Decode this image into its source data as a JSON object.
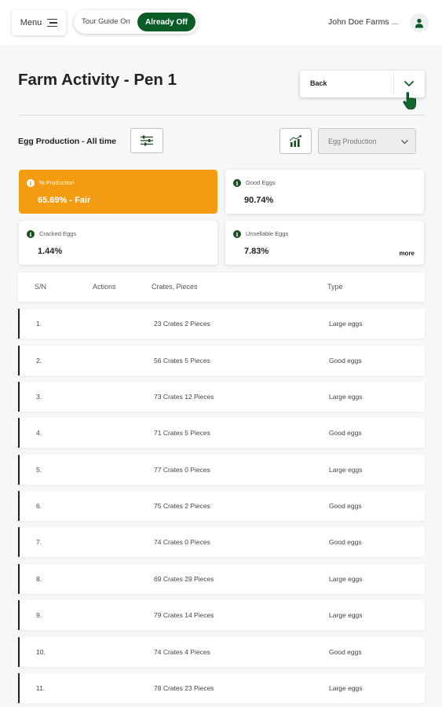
{
  "header": {
    "menu_label": "Menu",
    "tour_on_label": "Tour Guide On",
    "tour_off_label": "Already Off",
    "farm_name": "John Doe Farms ..."
  },
  "page": {
    "title": "Farm Activity - Pen 1",
    "back_label": "Back"
  },
  "filters": {
    "section_title": "Egg Production - All time",
    "select_value": "Egg Production"
  },
  "stats": [
    {
      "label": "% Production",
      "value": "65.69% - Fair",
      "highlight": true
    },
    {
      "label": "Good Eggs",
      "value": "90.74%"
    },
    {
      "label": "Cracked Eggs",
      "value": "1.44%"
    },
    {
      "label": "Unsellable Eggs",
      "value": "7.83%",
      "more": "more"
    }
  ],
  "table": {
    "headers": [
      "S/N",
      "Actions",
      "Crates, Pieces",
      "Type"
    ],
    "rows": [
      {
        "sn": "1.",
        "qty": "23 Crates 2 Pieces",
        "type": "Large eggs"
      },
      {
        "sn": "2.",
        "qty": "56 Crates 5 Pieces",
        "type": "Good eggs"
      },
      {
        "sn": "3.",
        "qty": "73 Crates 12 Pieces",
        "type": "Large eggs"
      },
      {
        "sn": "4.",
        "qty": "71 Crates 5 Pieces",
        "type": "Good eggs"
      },
      {
        "sn": "5.",
        "qty": "77 Crates 0 Pieces",
        "type": "Large eggs"
      },
      {
        "sn": "6.",
        "qty": "75 Crates 2 Pieces",
        "type": "Good eggs"
      },
      {
        "sn": "7.",
        "qty": "74 Crates 0 Pieces",
        "type": "Good eggs"
      },
      {
        "sn": "8.",
        "qty": "69 Crates 29 Pieces",
        "type": "Large eggs"
      },
      {
        "sn": "9.",
        "qty": "79 Crates 14 Pieces",
        "type": "Large eggs"
      },
      {
        "sn": "10.",
        "qty": "74 Crates 4 Pieces",
        "type": "Good eggs"
      },
      {
        "sn": "11.",
        "qty": "78 Crates 23 Pieces",
        "type": "Large eggs"
      }
    ]
  },
  "colors": {
    "brand_green": "#0b5b28",
    "highlight_orange": "#f39c12"
  },
  "icons": [
    "hamburger-icon",
    "user-icon",
    "chevron-down-icon",
    "hand-pointer-icon",
    "filter-sliders-icon",
    "bar-chart-icon",
    "info-icon"
  ]
}
